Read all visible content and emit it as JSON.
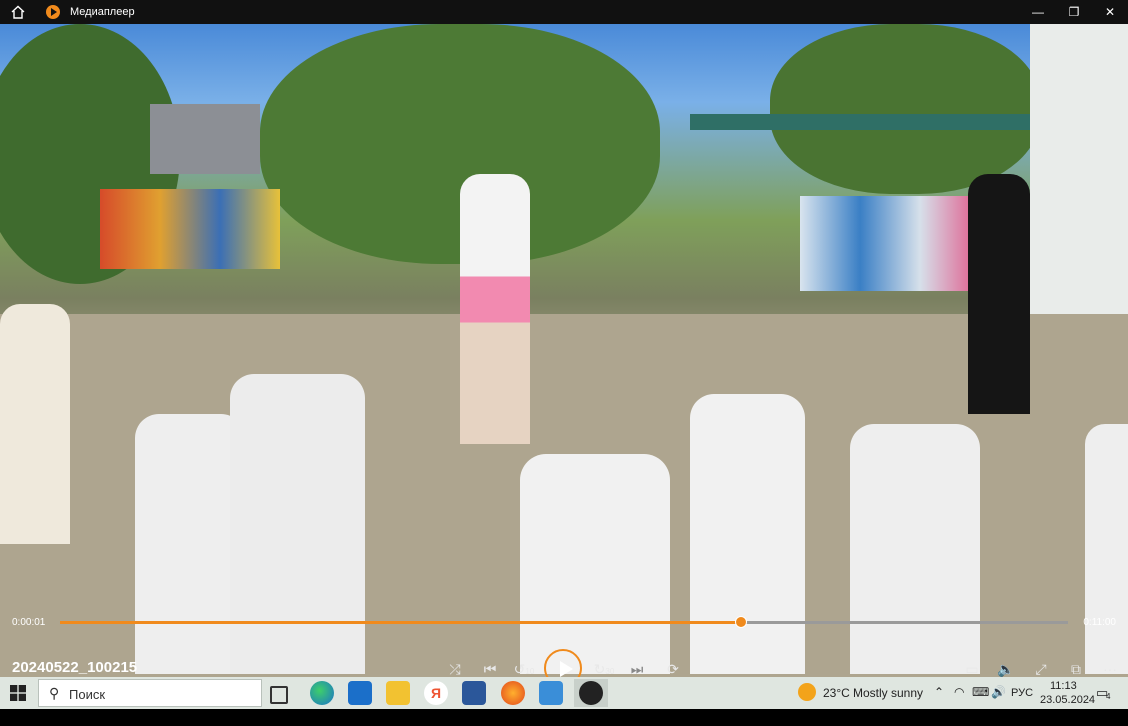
{
  "titlebar": {
    "app_title": "Медиаплеер",
    "minimize": "—",
    "restore": "❐",
    "close": "✕"
  },
  "player": {
    "media_title": "20240522_100215",
    "current_time": "0:00:01",
    "total_time": "0:11:00",
    "progress_fraction": 0.676,
    "accent_color": "#f08a1c"
  },
  "controls": {
    "shuffle": "⤮",
    "previous": "⏮",
    "rewind": "↺",
    "rewind_label": "10",
    "forward": "↻",
    "forward_label": "30",
    "next": "⏭",
    "repeat": "⟳",
    "captions": "▭",
    "volume": "🔈",
    "fullscreen": "⤢",
    "miniplayer": "⧉",
    "more": "···"
  },
  "taskbar": {
    "search_placeholder": "Поиск",
    "weather_temp": "23°C",
    "weather_text": "Mostly sunny",
    "language": "РУС",
    "time": "11:13",
    "date": "23.05.2024",
    "notification_count": "4"
  }
}
